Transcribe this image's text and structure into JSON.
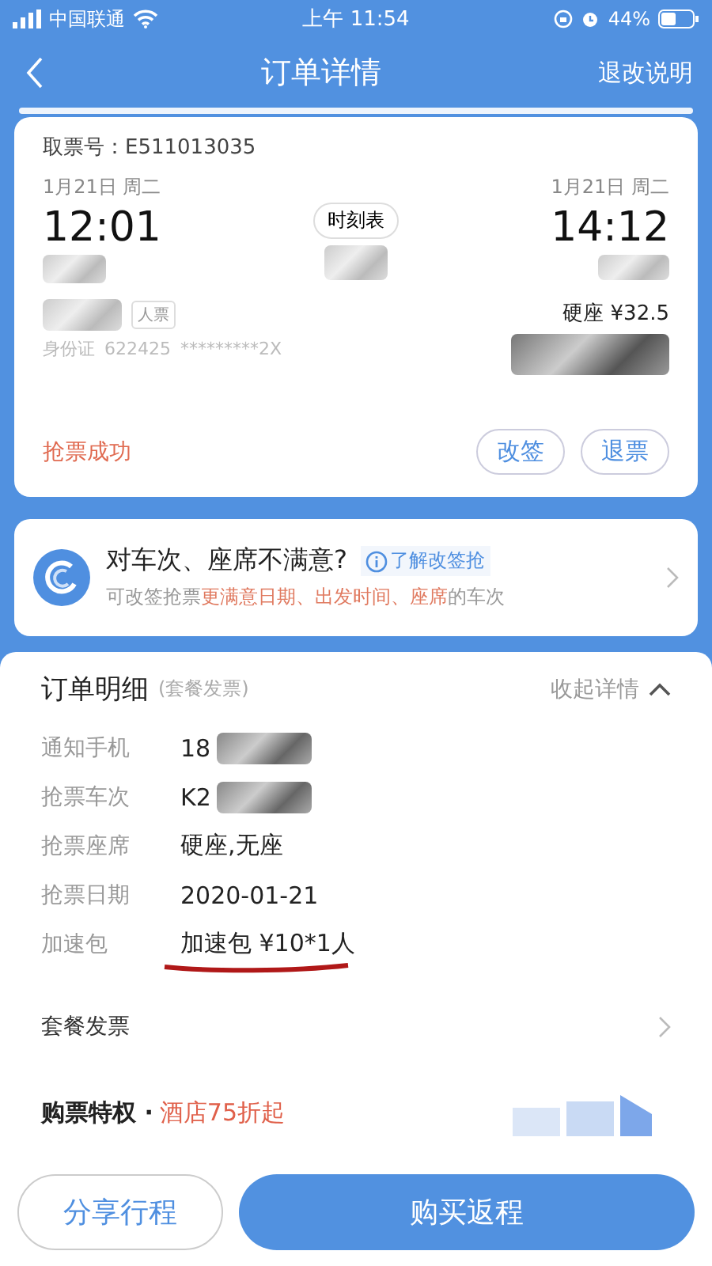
{
  "status_bar": {
    "carrier": "中国联通",
    "time": "上午 11:54",
    "battery": "44%"
  },
  "nav": {
    "title": "订单详情",
    "action": "退改说明"
  },
  "ticket": {
    "pickup": "取票号：E511013035",
    "depart": {
      "date": "1月21日  周二",
      "time": "12:01"
    },
    "arrive": {
      "date": "1月21日  周二",
      "time": "14:12"
    },
    "timetable": "时刻表",
    "ticket_type": "人票",
    "id_label": "身份证",
    "id_number": "622425",
    "id_tail": "*********2X",
    "seat_price": "硬座 ¥32.5",
    "status": "抢票成功",
    "buttons": [
      "改签",
      "退票"
    ]
  },
  "promo": {
    "title": "对车次、座席不满意?",
    "link": "了解改签抢",
    "subtitle": "可改签抢票**更满意日期、出发时间、座席**的车次"
  },
  "details": {
    "title": "订单明细",
    "note": "(套餐发票)",
    "toggle": "收起详情",
    "expanded": true,
    "rows": [
      {
        "label": "通知手机",
        "value": "18",
        "redacted": true,
        "underlined": false
      },
      {
        "label": "抢票车次",
        "value": "K2",
        "redacted": true,
        "underlined": false
      },
      {
        "label": "抢票座席",
        "value": "硬座,无座",
        "redacted": false,
        "underlined": false
      },
      {
        "label": "抢票日期",
        "value": "2020-01-21",
        "redacted": false,
        "underlined": false
      },
      {
        "label": "加速包",
        "value": "加速包 ¥10*1人",
        "redacted": false,
        "underlined": true
      }
    ],
    "invoice": "套餐发票",
    "perks": {
      "title": "购票特权 ·",
      "highlight": "酒店75折起"
    }
  },
  "bottom_buttons": [
    {
      "label": "分享行程",
      "kind": "outline"
    },
    {
      "label": "购买返程",
      "kind": "primary"
    }
  ]
}
